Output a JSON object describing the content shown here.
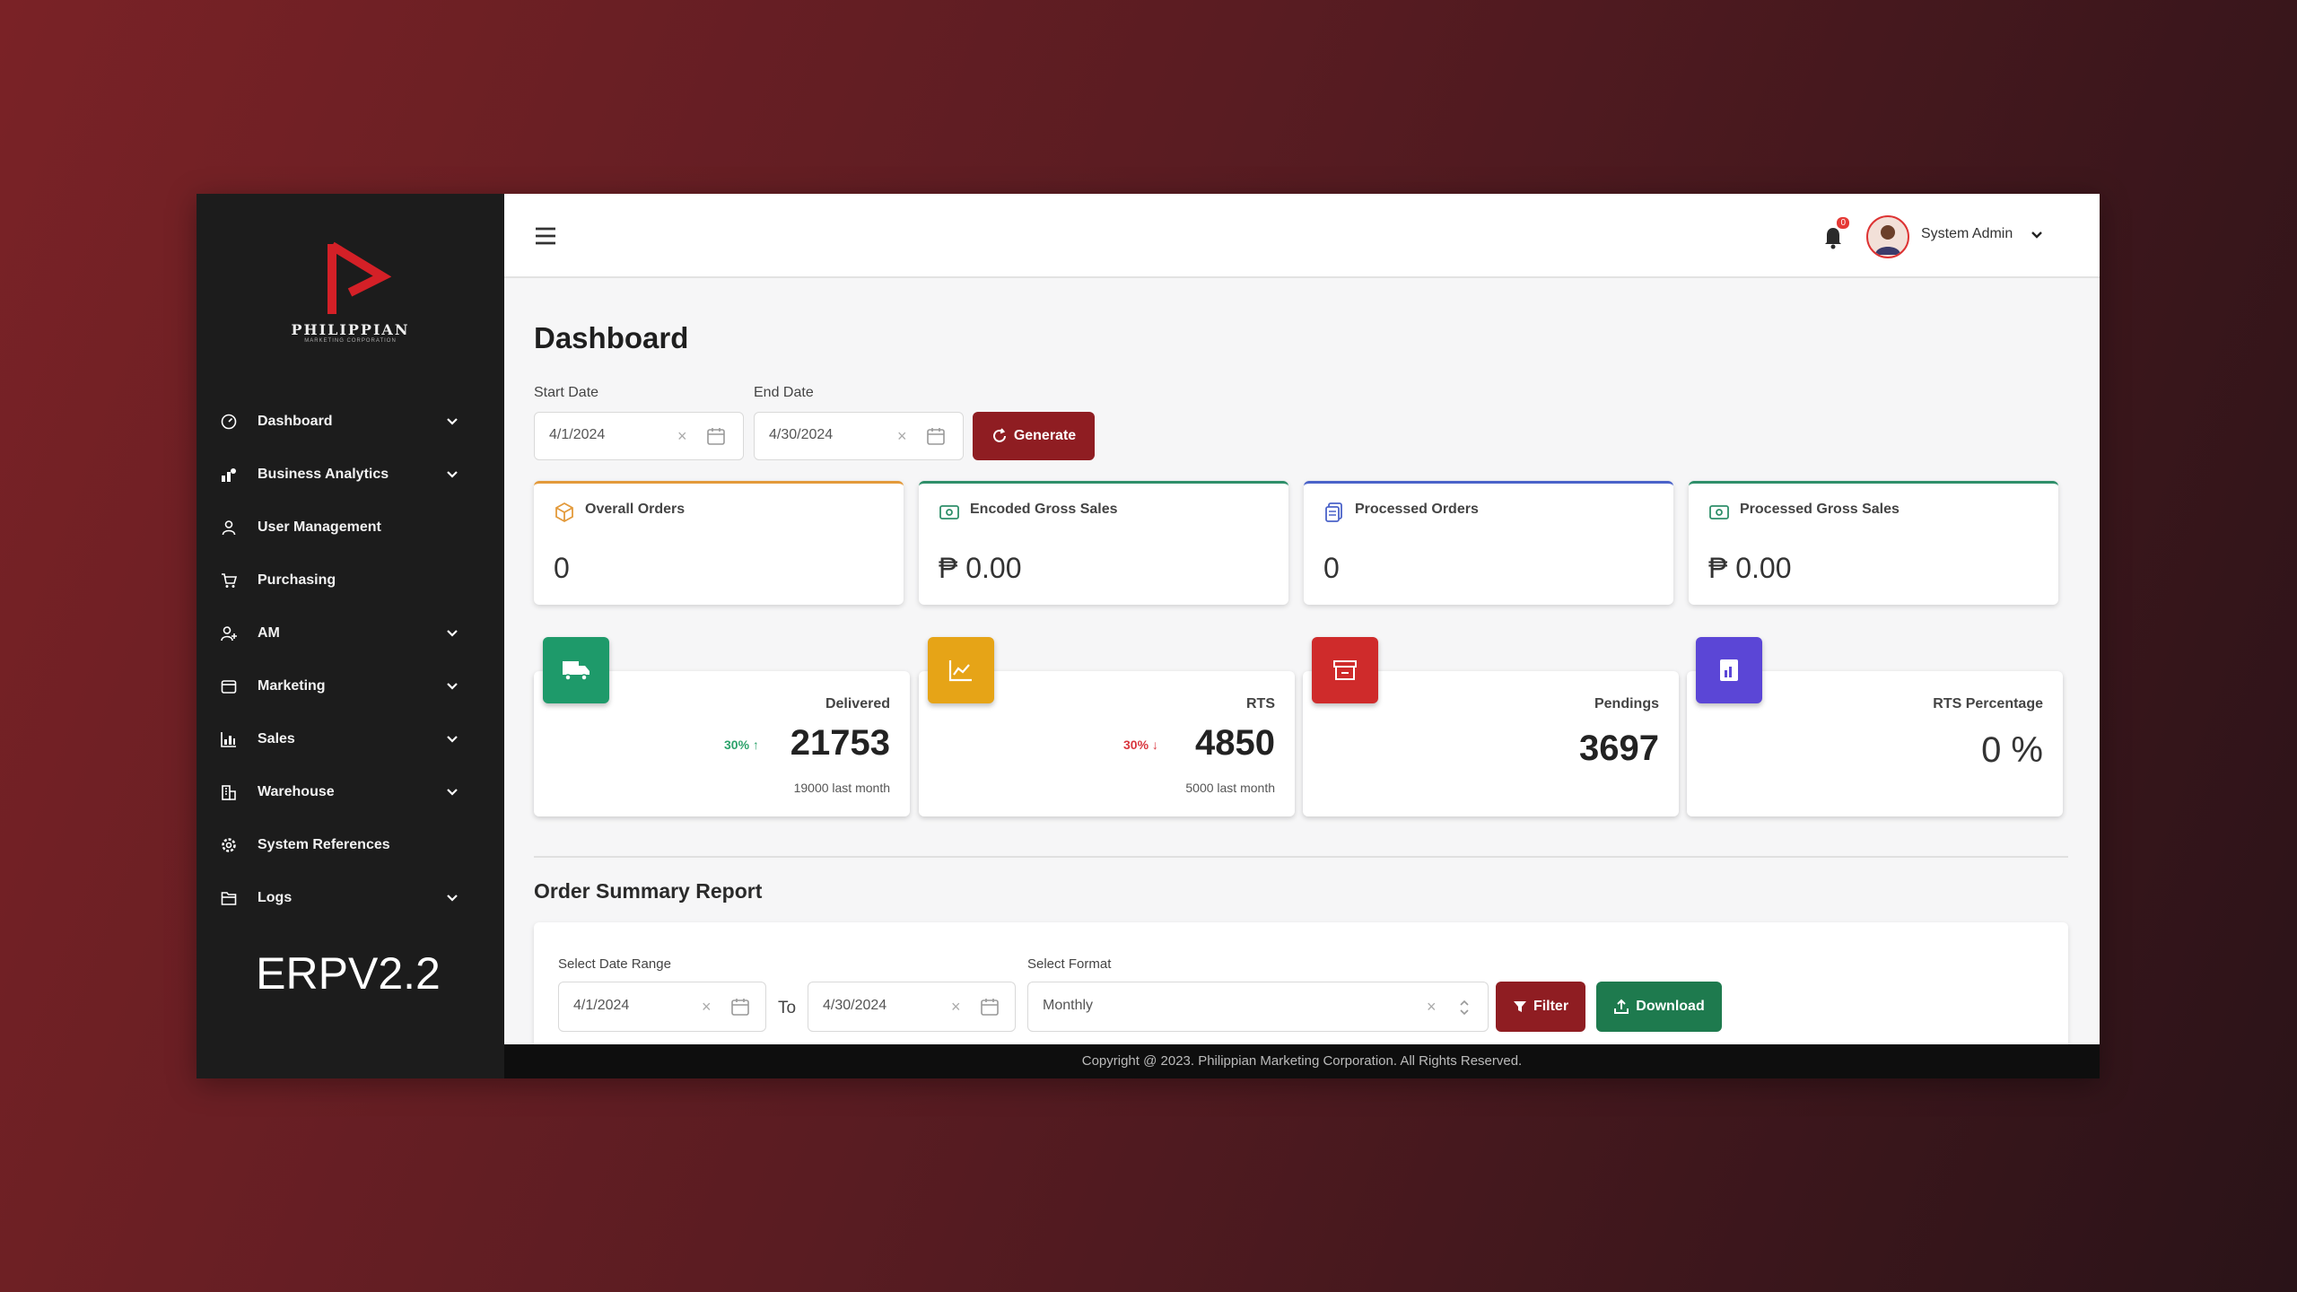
{
  "brand": {
    "name": "PHILIPPIAN",
    "sub": "MARKETING CORPORATION",
    "version": "ERPV2.2"
  },
  "sidebar": {
    "items": [
      {
        "label": "Dashboard",
        "icon": "gauge-icon",
        "has_chevron": true
      },
      {
        "label": "Business Analytics",
        "icon": "analytics-icon",
        "has_chevron": true
      },
      {
        "label": "User Management",
        "icon": "user-icon",
        "has_chevron": false
      },
      {
        "label": "Purchasing",
        "icon": "cart-icon",
        "has_chevron": false
      },
      {
        "label": "AM",
        "icon": "user-plus-icon",
        "has_chevron": true
      },
      {
        "label": "Marketing",
        "icon": "calendar-icon",
        "has_chevron": true
      },
      {
        "label": "Sales",
        "icon": "bar-chart-icon",
        "has_chevron": true
      },
      {
        "label": "Warehouse",
        "icon": "building-icon",
        "has_chevron": true
      },
      {
        "label": "System References",
        "icon": "gear-icon",
        "has_chevron": false
      },
      {
        "label": "Logs",
        "icon": "folder-icon",
        "has_chevron": true
      }
    ]
  },
  "topbar": {
    "notification_count": "0",
    "user_name": "System Admin"
  },
  "page": {
    "title": "Dashboard"
  },
  "filters": {
    "start_label": "Start Date",
    "start_value": "4/1/2024",
    "end_label": "End Date",
    "end_value": "4/30/2024",
    "generate_label": "Generate"
  },
  "stats": [
    {
      "title": "Overall Orders",
      "value": "0",
      "accent": "#e39a3b"
    },
    {
      "title": "Encoded Gross Sales",
      "value": "₱ 0.00",
      "accent": "#2f8f6a"
    },
    {
      "title": "Processed Orders",
      "value": "0",
      "accent": "#4b63c9"
    },
    {
      "title": "Processed Gross Sales",
      "value": "₱ 0.00",
      "accent": "#2f8f6a"
    }
  ],
  "kpis": [
    {
      "label": "Delivered",
      "value": "21753",
      "pct": "30% ↑",
      "pct_color": "#2ea36c",
      "sub": "19000 last month",
      "color": "#1e9a6a"
    },
    {
      "label": "RTS",
      "value": "4850",
      "pct": "30% ↓",
      "pct_color": "#d9363e",
      "sub": "5000 last month",
      "color": "#e6a417"
    },
    {
      "label": "Pendings",
      "value": "3697",
      "color": "#cf2b2b"
    },
    {
      "label": "RTS Percentage",
      "value": "0 %",
      "color": "#5b46d6"
    }
  ],
  "report": {
    "title": "Order Summary Report",
    "date_range_label": "Select Date Range",
    "from_value": "4/1/2024",
    "to_label": "To",
    "to_value": "4/30/2024",
    "format_label": "Select Format",
    "format_value": "Monthly",
    "filter_label": "Filter",
    "download_label": "Download"
  },
  "footer": {
    "text": "Copyright @ 2023. Philippian Marketing Corporation. All Rights Reserved."
  }
}
